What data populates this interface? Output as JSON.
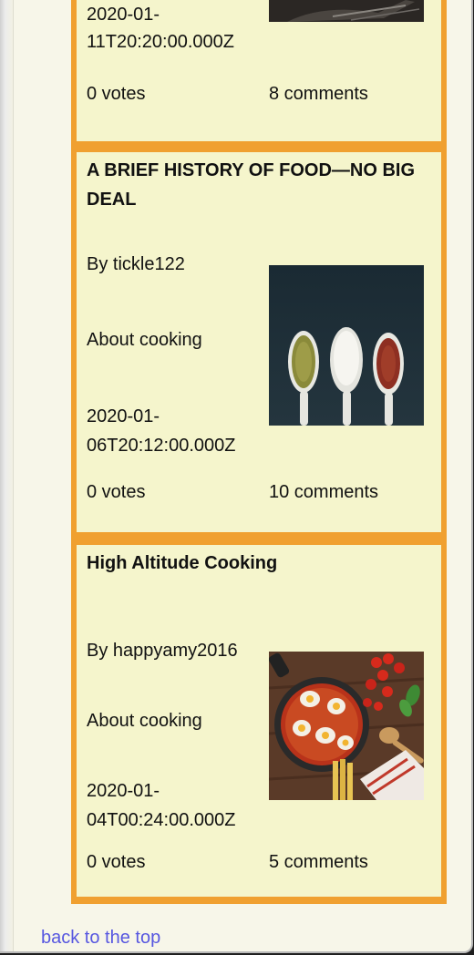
{
  "articles": [
    {
      "date_line1": "2020-01-",
      "date_line2": "11T20:20:00.000Z",
      "votes": "0 votes",
      "comments": "8 comments",
      "image_icon": "food-photo-icon"
    },
    {
      "title": "A BRIEF HISTORY OF FOOD—NO BIG DEAL",
      "author": "By tickle122",
      "topic": "About cooking",
      "date_line1": "2020-01-",
      "date_line2": "06T20:12:00.000Z",
      "votes": "0 votes",
      "comments": "10 comments",
      "image_icon": "spice-spoons-icon"
    },
    {
      "title": "High Altitude Cooking",
      "author": "By happyamy2016",
      "topic": "About cooking",
      "date_line1": "2020-01-",
      "date_line2": "04T00:24:00.000Z",
      "votes": "0 votes",
      "comments": "5 comments",
      "image_icon": "shakshuka-pan-icon"
    }
  ],
  "footer": {
    "back_to_top": "back to the top"
  },
  "colors": {
    "card_bg": "#f5f5cc",
    "card_border": "#f0a030",
    "link": "#5757e0",
    "page_bg": "#f7f6e9"
  }
}
